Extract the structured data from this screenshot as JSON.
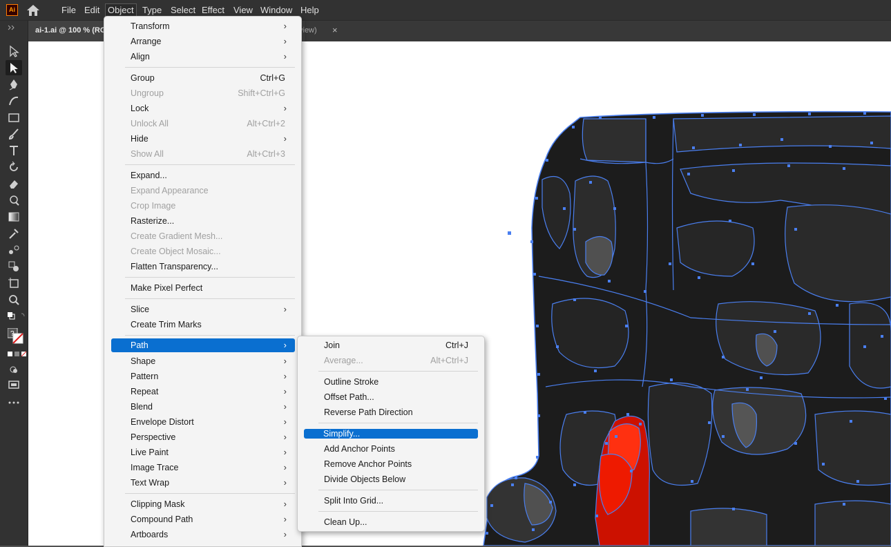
{
  "app": {
    "logo_text": "Ai",
    "brand_color": "#ff9a00"
  },
  "menubar": {
    "items": [
      "File",
      "Edit",
      "Object",
      "Type",
      "Select",
      "Effect",
      "View",
      "Window",
      "Help"
    ]
  },
  "doc_tab": {
    "title": "ai-1.ai @ 100 % (RG",
    "title_tail": "view)",
    "close": "×"
  },
  "object_menu": {
    "items": [
      {
        "label": "Transform"
      },
      {
        "label": "Arrange"
      },
      {
        "label": "Align"
      },
      {
        "label": "Group",
        "shortcut": "Ctrl+G"
      },
      {
        "label": "Ungroup",
        "shortcut": "Shift+Ctrl+G"
      },
      {
        "label": "Lock"
      },
      {
        "label": "Unlock All",
        "shortcut": "Alt+Ctrl+2"
      },
      {
        "label": "Hide"
      },
      {
        "label": "Show All",
        "shortcut": "Alt+Ctrl+3"
      },
      {
        "label": "Expand..."
      },
      {
        "label": "Expand Appearance"
      },
      {
        "label": "Crop Image"
      },
      {
        "label": "Rasterize..."
      },
      {
        "label": "Create Gradient Mesh..."
      },
      {
        "label": "Create Object Mosaic..."
      },
      {
        "label": "Flatten Transparency..."
      },
      {
        "label": "Make Pixel Perfect"
      },
      {
        "label": "Slice"
      },
      {
        "label": "Create Trim Marks"
      },
      {
        "label": "Path"
      },
      {
        "label": "Shape"
      },
      {
        "label": "Pattern"
      },
      {
        "label": "Repeat"
      },
      {
        "label": "Blend"
      },
      {
        "label": "Envelope Distort"
      },
      {
        "label": "Perspective"
      },
      {
        "label": "Live Paint"
      },
      {
        "label": "Image Trace"
      },
      {
        "label": "Text Wrap"
      },
      {
        "label": "Clipping Mask"
      },
      {
        "label": "Compound Path"
      },
      {
        "label": "Artboards"
      }
    ]
  },
  "path_submenu": {
    "items": [
      {
        "label": "Join",
        "shortcut": "Ctrl+J"
      },
      {
        "label": "Average...",
        "shortcut": "Alt+Ctrl+J"
      },
      {
        "label": "Outline Stroke"
      },
      {
        "label": "Offset Path..."
      },
      {
        "label": "Reverse Path Direction"
      },
      {
        "label": "Simplify..."
      },
      {
        "label": "Add Anchor Points"
      },
      {
        "label": "Remove Anchor Points"
      },
      {
        "label": "Divide Objects Below"
      },
      {
        "label": "Split Into Grid..."
      },
      {
        "label": "Clean Up..."
      }
    ]
  },
  "colors": {
    "highlight": "#0a6fd0",
    "selection_path": "#4a7ff0",
    "dark_fill": "#1c1c1c"
  }
}
